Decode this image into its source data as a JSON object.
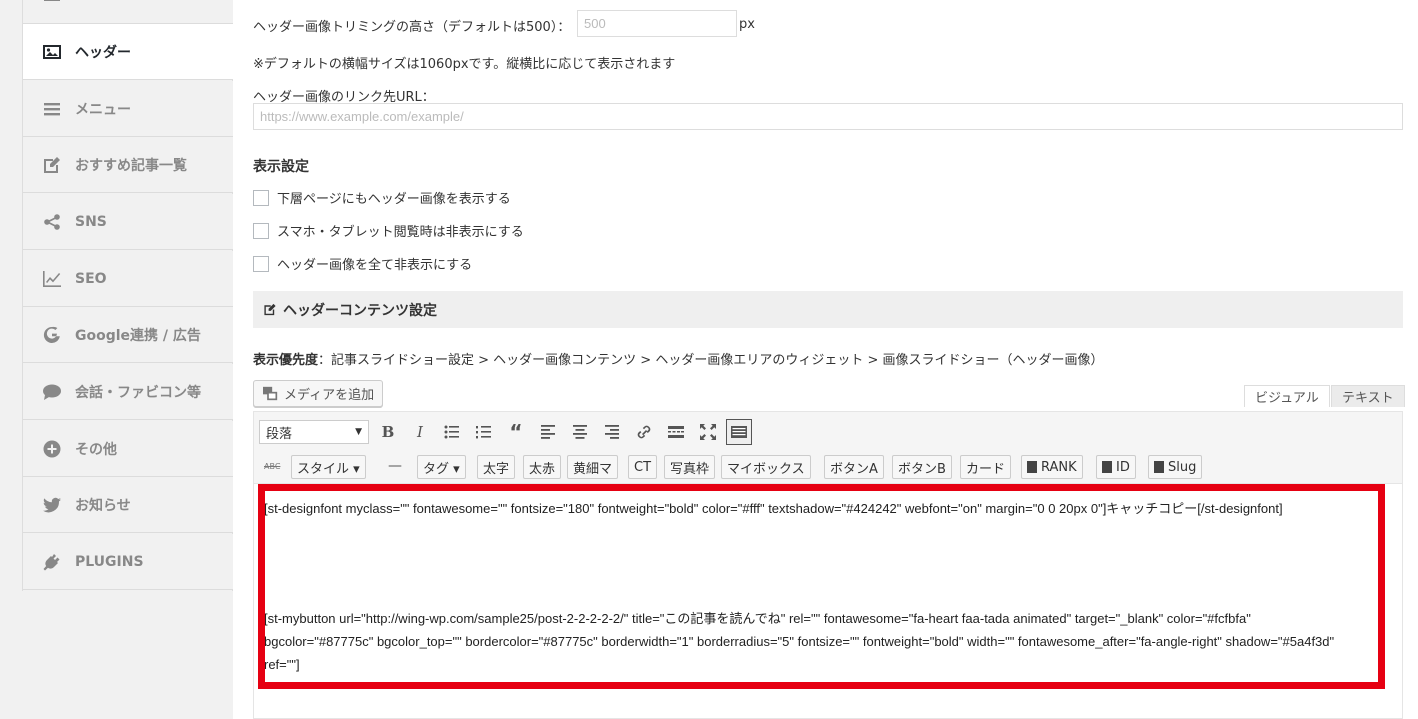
{
  "sidebar": {
    "items": [
      {
        "label": "",
        "icon": "menu-top-icon"
      },
      {
        "label": "ヘッダー",
        "icon": "image-icon"
      },
      {
        "label": "メニュー",
        "icon": "bars-icon"
      },
      {
        "label": "おすすめ記事一覧",
        "icon": "edit-icon"
      },
      {
        "label": "SNS",
        "icon": "share-icon"
      },
      {
        "label": "SEO",
        "icon": "line-chart-icon"
      },
      {
        "label": "Google連携 / 広告",
        "icon": "google-icon"
      },
      {
        "label": "会話・ファビコン等",
        "icon": "comment-icon"
      },
      {
        "label": "その他",
        "icon": "plus-circle-icon"
      },
      {
        "label": "お知らせ",
        "icon": "twitter-icon"
      },
      {
        "label": "PLUGINS",
        "icon": "plug-icon"
      }
    ]
  },
  "header_settings": {
    "trim_height_label": "ヘッダー画像トリミングの高さ（デフォルトは500）：",
    "trim_height_placeholder": "500",
    "trim_height_unit": "px",
    "width_note": "※デフォルトの横幅サイズは1060pxです。縦横比に応じて表示されます",
    "link_url_label": "ヘッダー画像のリンク先URL：",
    "link_url_placeholder": "https://www.example.com/example/"
  },
  "display": {
    "heading": "表示設定",
    "options": [
      "下層ページにもヘッダー画像を表示する",
      "スマホ・タブレット閲覧時は非表示にする",
      "ヘッダー画像を全て非表示にする"
    ]
  },
  "content_section": {
    "title": "ヘッダーコンテンツ設定",
    "priority_label": "表示優先度",
    "priority_text": "：記事スライドショー設定 > ヘッダー画像コンテンツ > ヘッダー画像エリアのウィジェット > 画像スライドショー（ヘッダー画像）"
  },
  "editor": {
    "add_media": "メディアを追加",
    "tab_visual": "ビジュアル",
    "tab_text": "テキスト",
    "format_select": "段落",
    "row2": [
      "スタイル ▾",
      "タグ ▾",
      "太字",
      "太赤",
      "黄細マ",
      "CT",
      "写真枠",
      "マイボックス",
      "ボタンA",
      "ボタンB",
      "カード",
      "RANK",
      "ID",
      "Slug"
    ],
    "row2_abc": "ABC",
    "row2_dash": "—",
    "content_line1": "[st-designfont myclass=\"\" fontawesome=\"\" fontsize=\"180\" fontweight=\"bold\" color=\"#fff\" textshadow=\"#424242\" webfont=\"on\" margin=\"0 0 20px 0\"]キャッチコピー[/st-designfont]",
    "content_line2": "[st-mybutton url=\"http://wing-wp.com/sample25/post-2-2-2-2-2/\" title=\"この記事を読んでね\" rel=\"\" fontawesome=\"fa-heart faa-tada animated\" target=\"_blank\" color=\"#fcfbfa\" bgcolor=\"#87775c\" bgcolor_top=\"\" bordercolor=\"#87775c\" borderwidth=\"1\" borderradius=\"5\" fontsize=\"\" fontweight=\"bold\" width=\"\" fontawesome_after=\"fa-angle-right\" shadow=\"#5a4f3d\" ref=\"\"]"
  },
  "colors": {
    "highlight_frame": "#e60012"
  }
}
